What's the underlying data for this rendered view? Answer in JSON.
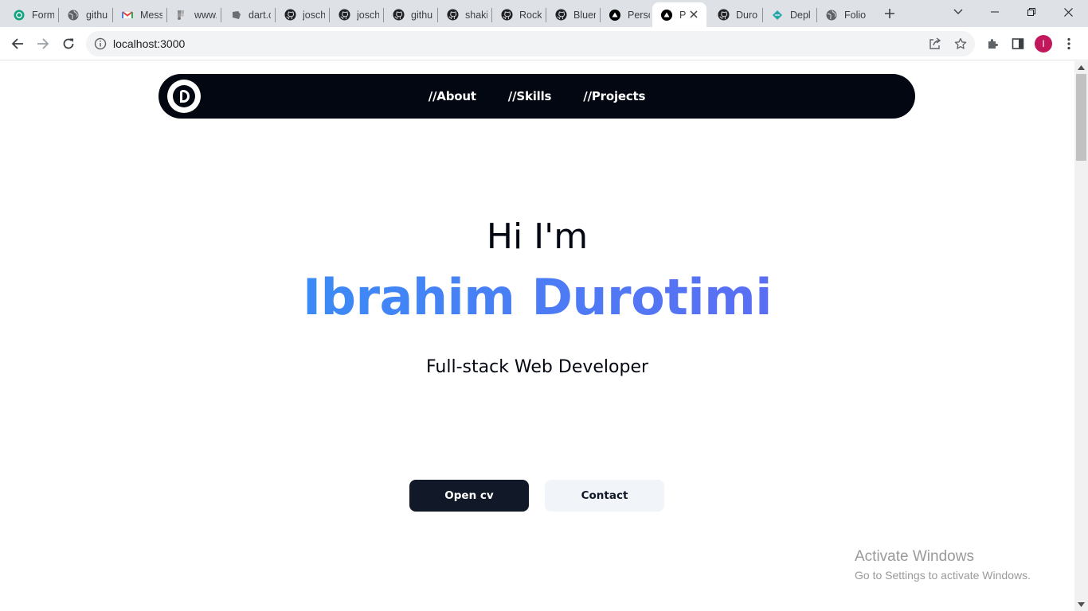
{
  "browser": {
    "tabs": [
      {
        "title": "Form",
        "icon": "openai-icon"
      },
      {
        "title": "githu",
        "icon": "globe-icon"
      },
      {
        "title": "Mess",
        "icon": "gmail-icon"
      },
      {
        "title": "www.",
        "icon": "figma-icon"
      },
      {
        "title": "dart.c",
        "icon": "dart-icon"
      },
      {
        "title": "josch",
        "icon": "github-icon"
      },
      {
        "title": "josch",
        "icon": "github-icon"
      },
      {
        "title": "githu",
        "icon": "github-icon"
      },
      {
        "title": "shaki",
        "icon": "github-icon"
      },
      {
        "title": "Rock",
        "icon": "github-icon"
      },
      {
        "title": "Bluer",
        "icon": "github-icon"
      },
      {
        "title": "Perso",
        "icon": "vercel-icon"
      },
      {
        "title": "P",
        "icon": "vercel-icon",
        "active": true
      },
      {
        "title": "Duro",
        "icon": "github-icon"
      },
      {
        "title": "Depl",
        "icon": "netlify-icon"
      },
      {
        "title": "Folio",
        "icon": "globe-icon"
      }
    ],
    "address": "localhost:3000",
    "profile_initial": "I",
    "profile_color": "#c2185b"
  },
  "page": {
    "nav": {
      "links": [
        "//About",
        "//Skills",
        "//Projects"
      ]
    },
    "hero": {
      "greeting": "Hi I'm",
      "name": "Ibrahim Durotimi",
      "role": "Full-stack Web Developer"
    },
    "buttons": {
      "cv": "Open cv",
      "contact": "Contact"
    },
    "colors": {
      "navbar": "#030712",
      "name_gradient_start": "#3b8bf6",
      "name_gradient_end": "#5b6ef4",
      "primary_button": "#111827",
      "secondary_button": "#f1f4f8"
    }
  },
  "os_watermark": {
    "title": "Activate Windows",
    "subtitle": "Go to Settings to activate Windows."
  }
}
